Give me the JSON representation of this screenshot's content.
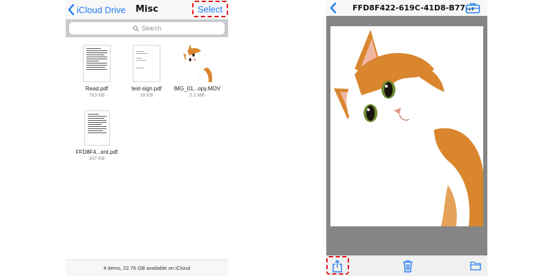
{
  "left_screen": {
    "nav": {
      "back_label": "iCloud Drive",
      "title": "Misc",
      "select_label": "Select"
    },
    "search": {
      "placeholder": "Search"
    },
    "files": [
      {
        "name": "Read.pdf",
        "size": "763 KB",
        "thumb": "document"
      },
      {
        "name": "test-sign.pdf",
        "size": "18 KB",
        "thumb": "blank-document"
      },
      {
        "name": "IMG_01...opy.MOV",
        "size": "3.2 MB",
        "thumb": "cat-photo"
      },
      {
        "name": "FFD8F4...ent.pdf",
        "size": "337 KB",
        "thumb": "document"
      }
    ],
    "footer": "4 items, 22.76 GB available on iCloud"
  },
  "right_screen": {
    "nav": {
      "title": "FFD8F422-619C-41D8-B77..."
    },
    "toolbar": {
      "icons": [
        "share-icon",
        "trash-icon",
        "folder-icon"
      ]
    }
  },
  "colors": {
    "accent": "#1f7cf2",
    "highlight": "#e6131b",
    "preview_background": "#858585"
  }
}
